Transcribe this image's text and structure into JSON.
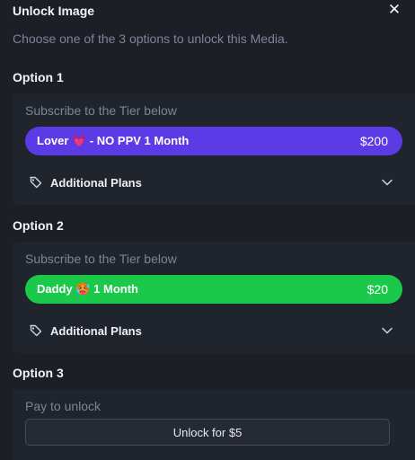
{
  "modal": {
    "title": "Unlock Image",
    "close_icon": "close-icon",
    "subtitle": "Choose one of the 3 options to unlock this Media."
  },
  "options": [
    {
      "label": "Option 1",
      "caption": "Subscribe to the Tier below",
      "tier": {
        "name": "Lover",
        "emoji": "💗",
        "suffix": "- NO PPV 1 Month",
        "price": "$200",
        "color": "#5b3be6"
      },
      "plans_label": "Additional Plans",
      "plans_icon": "tag-icon",
      "expand_icon": "chevron-down-icon"
    },
    {
      "label": "Option 2",
      "caption": "Subscribe to the Tier below",
      "tier": {
        "name": "Daddy",
        "emoji": "🥵",
        "suffix": "1 Month",
        "price": "$20",
        "color": "#1bc94a"
      },
      "plans_label": "Additional Plans",
      "plans_icon": "tag-icon",
      "expand_icon": "chevron-down-icon"
    },
    {
      "label": "Option 3",
      "caption": "Pay to unlock",
      "button_label": "Unlock for $5"
    }
  ]
}
